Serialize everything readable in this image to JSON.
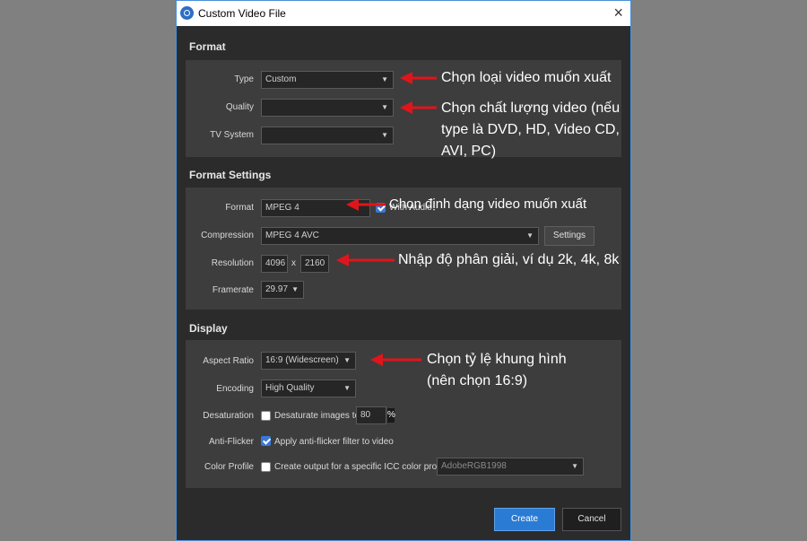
{
  "dialog": {
    "title": "Custom Video File",
    "close_icon": "×"
  },
  "format": {
    "heading": "Format",
    "type_label": "Type",
    "type_value": "Custom",
    "quality_label": "Quality",
    "quality_value": "",
    "tv_label": "TV System",
    "tv_value": ""
  },
  "format_settings": {
    "heading": "Format Settings",
    "format_label": "Format",
    "format_value": "MPEG 4",
    "with_audio_label": "With Audio",
    "compression_label": "Compression",
    "compression_value": "MPEG 4 AVC",
    "settings_button": "Settings",
    "resolution_label": "Resolution",
    "res_width": "4096",
    "res_x": "x",
    "res_height": "2160",
    "framerate_label": "Framerate",
    "framerate_value": "29.97"
  },
  "display": {
    "heading": "Display",
    "aspect_label": "Aspect Ratio",
    "aspect_value": "16:9 (Widescreen)",
    "encoding_label": "Encoding",
    "encoding_value": "High Quality",
    "desat_label": "Desaturation",
    "desat_text": "Desaturate images to",
    "desat_value": "80",
    "desat_unit": "%",
    "desat_checked": false,
    "antiflicker_label": "Anti-Flicker",
    "antiflicker_text": "Apply anti-flicker filter to video",
    "antiflicker_checked": true,
    "colorprofile_label": "Color Profile",
    "colorprofile_text": "Create output for a specific ICC color profile:",
    "colorprofile_value": "AdobeRGB1998",
    "colorprofile_checked": false
  },
  "footer": {
    "create_button": "Create",
    "cancel_button": "Cancel"
  },
  "annotations": {
    "type": "Chọn loại video muốn xuất",
    "quality_l1": "Chọn chất lượng video (nếu",
    "quality_l2": "type là DVD, HD, Video CD,",
    "quality_l3": "AVI, PC)",
    "format": "Chọn định dạng video muốn xuất",
    "resolution": "Nhập độ phân giải, ví dụ 2k, 4k, 8k",
    "aspect_l1": "Chọn tỷ lệ khung hình",
    "aspect_l2": "(nên chọn 16:9)"
  },
  "colors": {
    "accent": "#2a7bd4",
    "arrow": "#e0151b",
    "dialog_bg": "#2b2b2b",
    "panel_bg": "#3d3d3d"
  }
}
